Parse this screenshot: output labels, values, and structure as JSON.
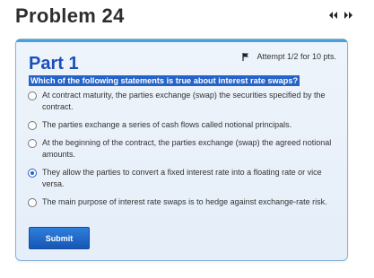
{
  "problem": {
    "title": "Problem 24"
  },
  "nav": {
    "prev_icon": "double-chevron-left-icon",
    "next_icon": "double-chevron-right-icon"
  },
  "part": {
    "title": "Part 1",
    "attempt_text": "Attempt 1/2 for 10 pts.",
    "flag_icon": "flag-icon"
  },
  "question": {
    "text": "Which of the following statements is true about interest rate swaps?",
    "options": [
      {
        "label": "At contract maturity, the parties exchange (swap) the securities specified by the contract.",
        "selected": false
      },
      {
        "label": "The parties exchange a series of cash flows called notional principals.",
        "selected": false
      },
      {
        "label": "At the beginning of the contract, the parties exchange (swap) the agreed notional amounts.",
        "selected": false
      },
      {
        "label": "They allow the parties to convert a fixed interest rate into a floating rate or vice versa.",
        "selected": true
      },
      {
        "label": "The main purpose of interest rate swaps is to hedge against exchange-rate risk.",
        "selected": false
      }
    ]
  },
  "submit": {
    "label": "Submit"
  },
  "colors": {
    "accent": "#2563c9",
    "part_title": "#1b4fb8",
    "card_border": "#8ab4d8"
  }
}
